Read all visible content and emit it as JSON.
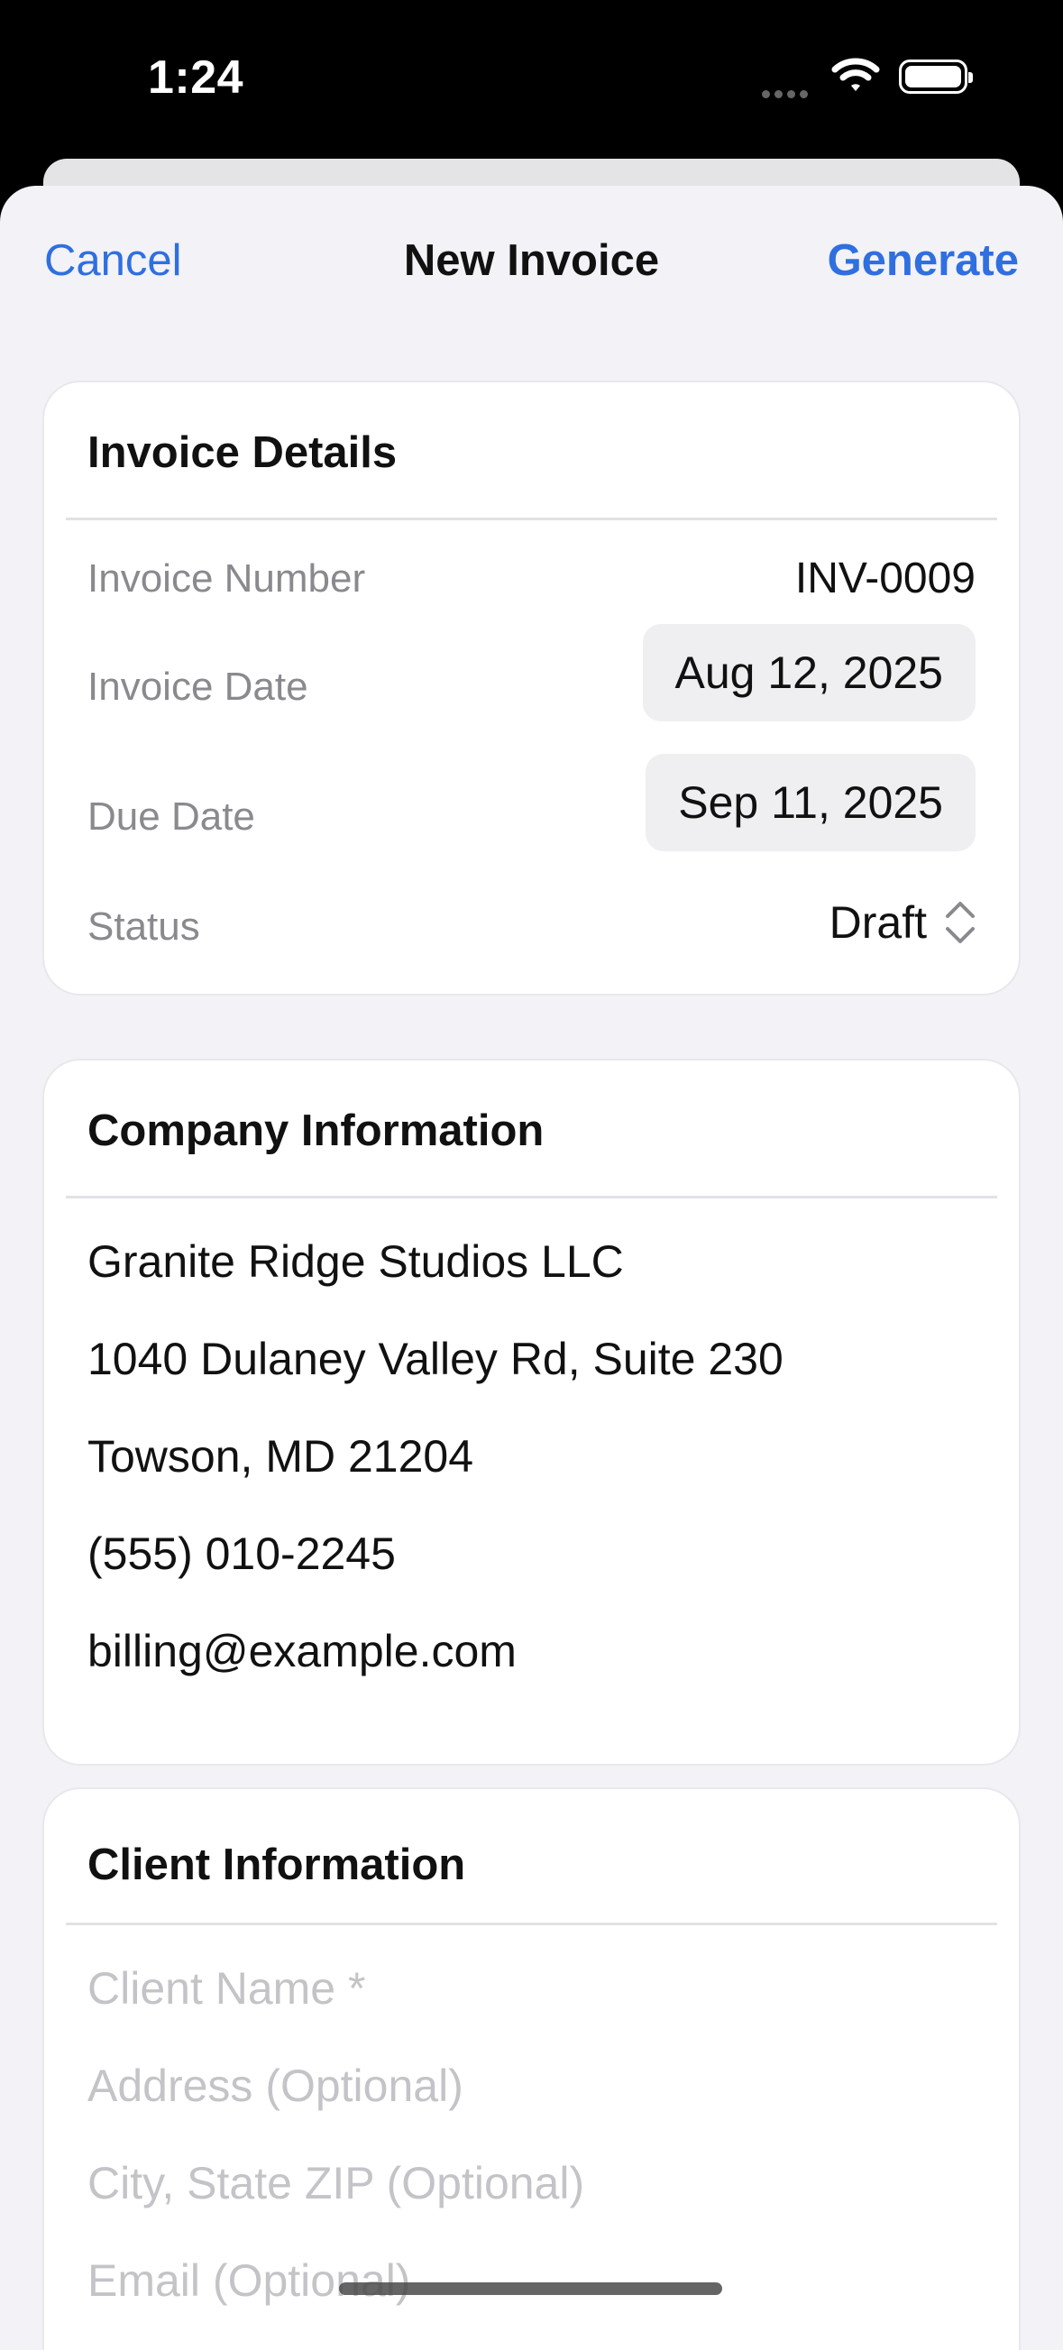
{
  "status_bar": {
    "time": "1:24"
  },
  "nav": {
    "cancel": "Cancel",
    "title": "New Invoice",
    "generate": "Generate"
  },
  "invoice_details": {
    "title": "Invoice Details",
    "number_label": "Invoice Number",
    "number_value": "INV-0009",
    "date_label": "Invoice Date",
    "date_value": "Aug 12, 2025",
    "due_label": "Due Date",
    "due_value": "Sep 11, 2025",
    "status_label": "Status",
    "status_value": "Draft"
  },
  "company": {
    "title": "Company Information",
    "name": "Granite Ridge Studios LLC",
    "address": "1040 Dulaney Valley Rd, Suite 230",
    "city": "Towson, MD 21204",
    "phone": "(555) 010-2245",
    "email": "billing@example.com"
  },
  "client": {
    "title": "Client Information",
    "name_placeholder": "Client Name *",
    "address_placeholder": "Address (Optional)",
    "city_placeholder": "City, State ZIP (Optional)",
    "email_placeholder": "Email (Optional)"
  },
  "colors": {
    "accent": "#2f6fe0",
    "background": "#f2f2f7",
    "label_gray": "#8a8a8e",
    "placeholder_gray": "#c4c4c8"
  }
}
